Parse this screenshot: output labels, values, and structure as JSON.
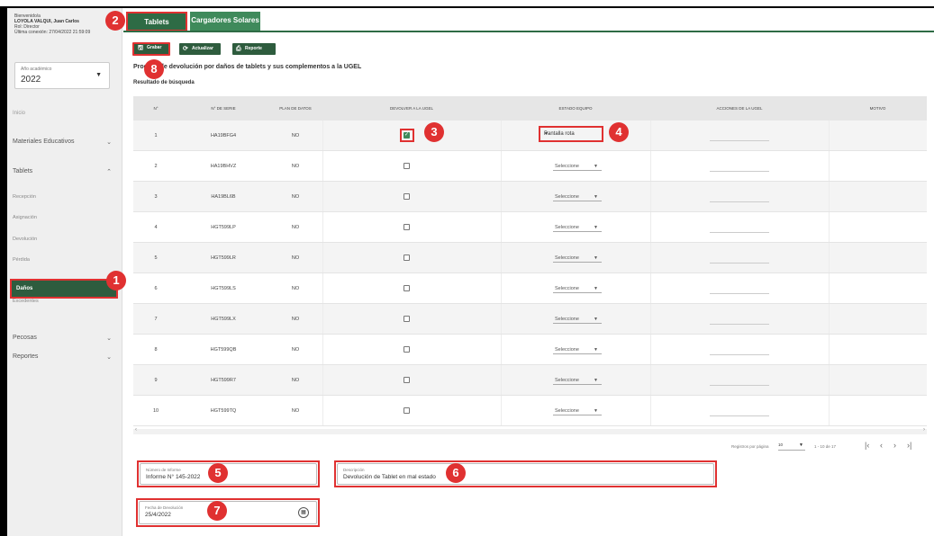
{
  "sidebar": {
    "greeting": "Bienvenido/a",
    "user_name": "LOYOLA VALQUI, Juan Carlos",
    "role": "Rol: Director",
    "last_login": "Última conexión: 27/04/2022 21:59:09",
    "year_label": "Año académico",
    "year_value": "2022",
    "items": [
      {
        "label": "Inicio"
      },
      {
        "label": "Materiales Educativos"
      },
      {
        "label": "Tablets"
      },
      {
        "label": "Recepción"
      },
      {
        "label": "Asignación"
      },
      {
        "label": "Devolución"
      },
      {
        "label": "Pérdida"
      },
      {
        "label": "Daños"
      },
      {
        "label": "Excedentes"
      },
      {
        "label": "Pecosas"
      },
      {
        "label": "Reportes"
      }
    ]
  },
  "tabs": {
    "tablets": "Tablets",
    "cargadores": "Cargadores Solares"
  },
  "toolbar": {
    "grabar": "Grabar",
    "actualizar": "Actualizar",
    "reporte": "Reporte"
  },
  "page_title": "Proceso de devolución por daños de tablets y sus complementos a la UGEL",
  "result_label": "Resultado de búsqueda",
  "table": {
    "headers": [
      "N°",
      "N° DE SERIE",
      "PLAN DE DATOS",
      "DEVOLVER A LA UGEL",
      "ESTADO EQUIPO",
      "ACCIONES DE LA UGEL",
      "MOTIVO"
    ],
    "rows": [
      {
        "n": "1",
        "serie": "HA19BFG4",
        "plan": "NO",
        "devolver": true,
        "estado": "Pantalla rota"
      },
      {
        "n": "2",
        "serie": "HA19BHVZ",
        "plan": "NO",
        "devolver": false,
        "estado": "Seleccione"
      },
      {
        "n": "3",
        "serie": "HA19BL6B",
        "plan": "NO",
        "devolver": false,
        "estado": "Seleccione"
      },
      {
        "n": "4",
        "serie": "HGT599LP",
        "plan": "NO",
        "devolver": false,
        "estado": "Seleccione"
      },
      {
        "n": "5",
        "serie": "HGT599LR",
        "plan": "NO",
        "devolver": false,
        "estado": "Seleccione"
      },
      {
        "n": "6",
        "serie": "HGT599LS",
        "plan": "NO",
        "devolver": false,
        "estado": "Seleccione"
      },
      {
        "n": "7",
        "serie": "HGT599LX",
        "plan": "NO",
        "devolver": false,
        "estado": "Seleccione"
      },
      {
        "n": "8",
        "serie": "HGT599QB",
        "plan": "NO",
        "devolver": false,
        "estado": "Seleccione"
      },
      {
        "n": "9",
        "serie": "HGT599R7",
        "plan": "NO",
        "devolver": false,
        "estado": "Seleccione"
      },
      {
        "n": "10",
        "serie": "HGT599TQ",
        "plan": "NO",
        "devolver": false,
        "estado": "Seleccione"
      }
    ]
  },
  "pager": {
    "per_page_label": "Registros por página",
    "per_page": "10",
    "range": "1 - 10 de 17"
  },
  "form": {
    "informe_label": "Número de Informe",
    "informe_value": "Informe N° 145-2022",
    "desc_label": "Descripción",
    "desc_value": "Devolución de Tablet en mal estado",
    "fecha_label": "Fecha de Devolución",
    "fecha_value": "25/4/2022"
  },
  "badges": [
    "1",
    "2",
    "3",
    "4",
    "5",
    "6",
    "7",
    "8"
  ],
  "colors": {
    "accent": "#2e6b45",
    "highlight": "#e03131"
  }
}
